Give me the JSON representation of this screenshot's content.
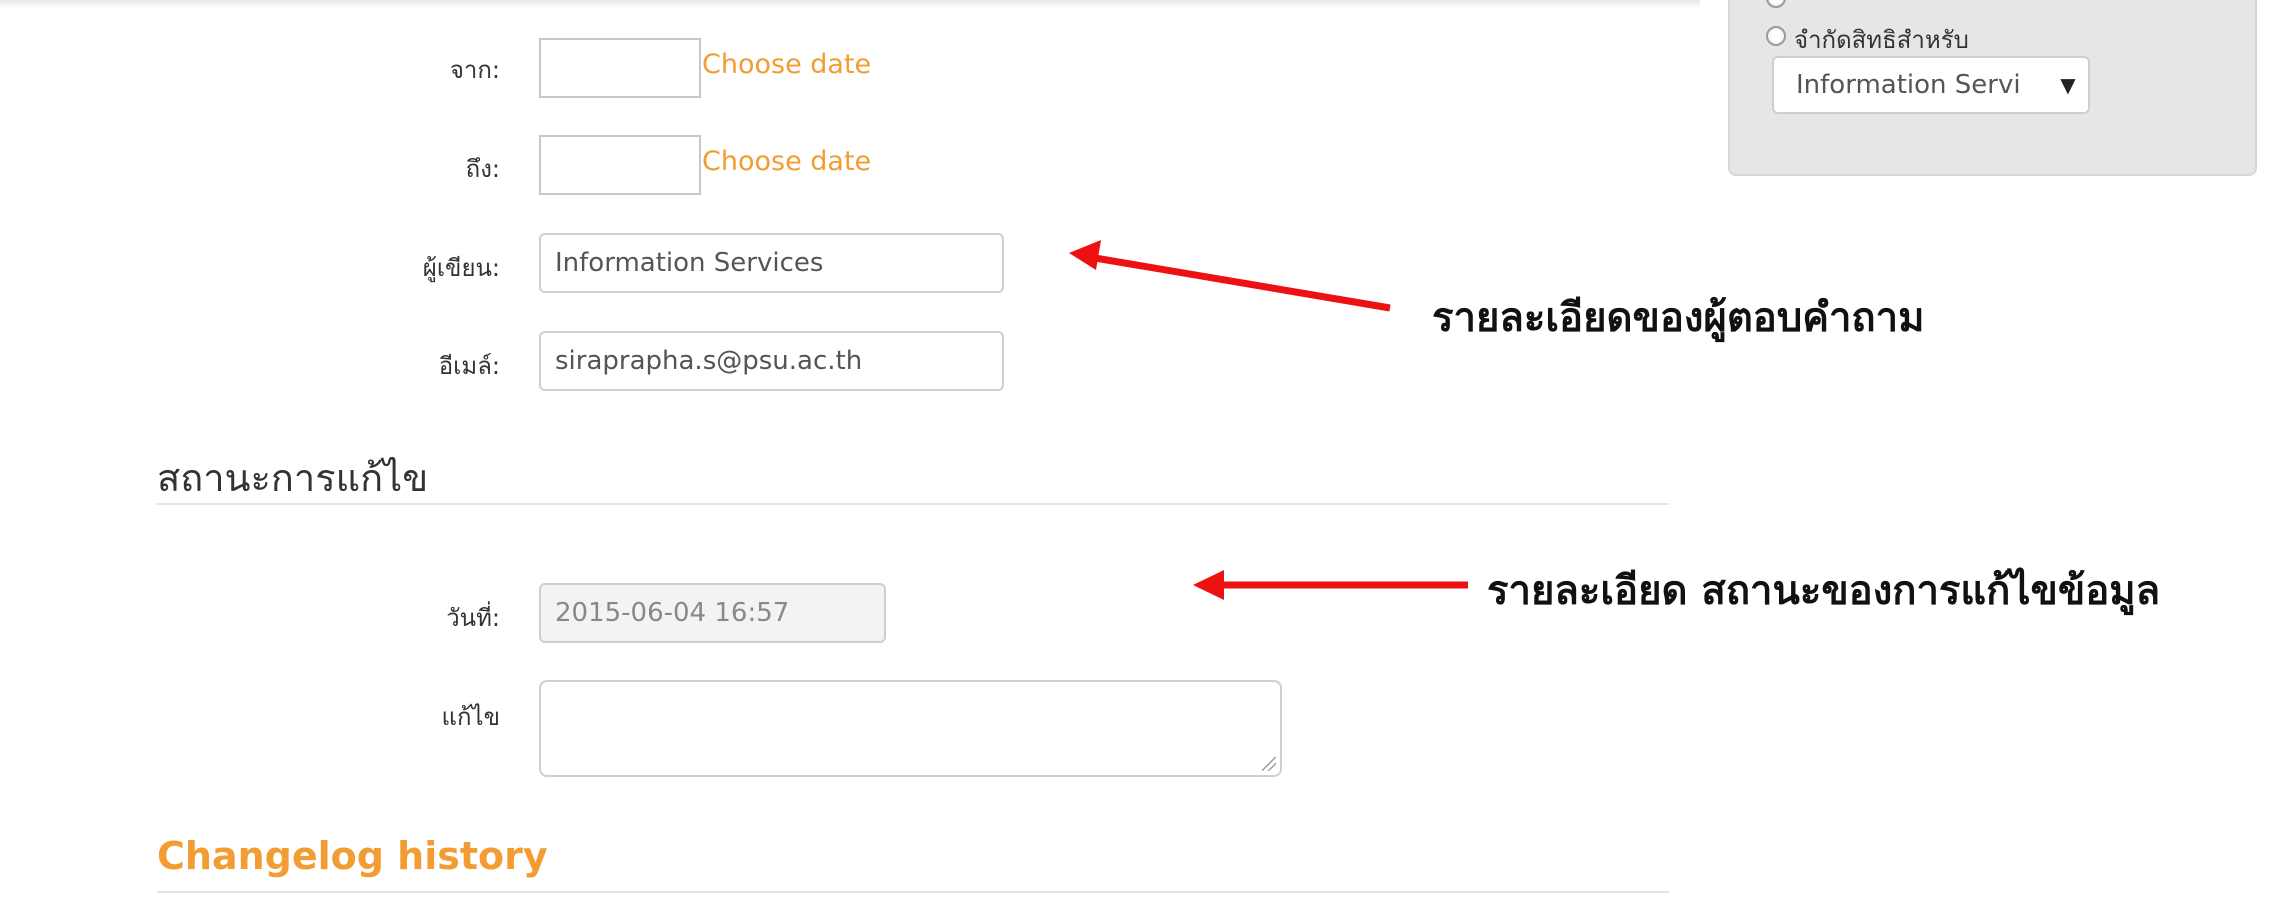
{
  "form": {
    "from_label": "จาก:",
    "from_choose": "Choose date",
    "to_label": "ถึง:",
    "to_choose": "Choose date",
    "author_label": "ผู้เขียน:",
    "author_value": "Information Services",
    "email_label": "อีเมล์:",
    "email_value": "siraprapha.s@psu.ac.th"
  },
  "edit_status": {
    "title": "สถานะการแก้ไข",
    "date_label": "วันที่:",
    "date_value": "2015-06-04 16:57",
    "edit_label": "แก้ไข"
  },
  "changelog": {
    "title": "Changelog history"
  },
  "side_panel": {
    "restrict_label": "จำกัดสิทธิสำหรับ",
    "select_value": "Information Servi",
    "caret": "▼"
  },
  "annotations": {
    "author_note": "รายละเอียดของผู้ตอบคำถาม",
    "status_note": "รายละเอียด สถานะของการแก้ไขข้อมูล",
    "arrow_color": "#ee1111"
  }
}
